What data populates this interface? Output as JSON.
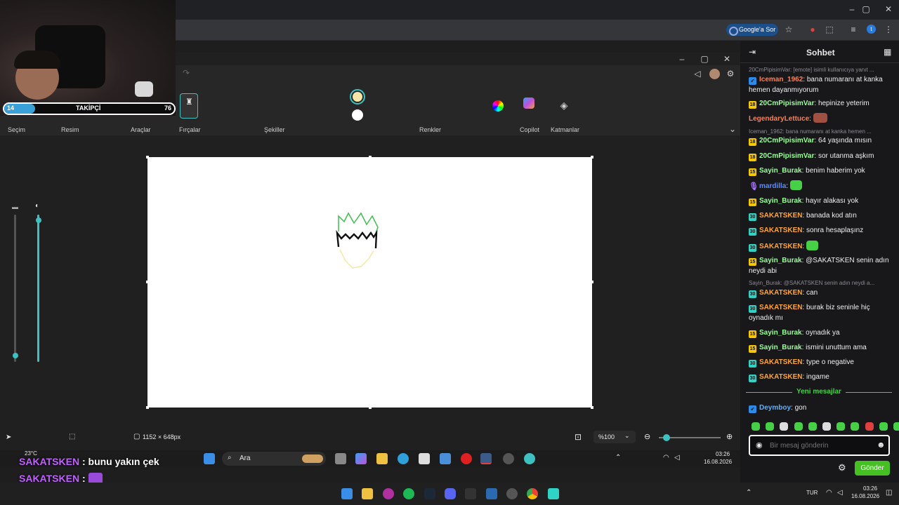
{
  "browser": {
    "ask_label": "Google'a Sor",
    "profile_initial": "t"
  },
  "follower_bar": {
    "current": "14",
    "label": "TAKİPÇİ",
    "goal": "76",
    "progress_fraction": 0.18
  },
  "paint": {
    "ribbon_groups": [
      "Seçim",
      "Resim",
      "Araçlar",
      "Fırçalar",
      "Şekiller",
      "Renkler",
      "Copilot",
      "Katmanlar"
    ],
    "canvas_size": "1152 × 648px",
    "zoom": "%100",
    "colors_row1": [
      "#1b1b1b",
      "#7a7a7a",
      "#8b1a1a",
      "#e02020",
      "#ef7a2b",
      "#f5e23a",
      "#3fbf50",
      "#2ea9df",
      "#3f54c9",
      "#8a3fb8"
    ],
    "colors_row2": [
      "#ffffff",
      "#bdbdbd",
      "#9c6a3c",
      "#f4a8c0",
      "#ffc618",
      "#e8e6a0",
      "#b6e05a",
      "#9bd8ec",
      "#6d7fd0",
      "#b49ad6"
    ],
    "active_color": "#f3e6a8"
  },
  "chat": {
    "title": "Sohbet",
    "new_messages_label": "Yeni mesajlar",
    "input_placeholder": "Bir mesaj gönderin",
    "send_label": "Gönder",
    "messages": [
      {
        "reply": "20CmPipisimVar: [emote] isimli kullanıcıya yanıt ...",
        "badge": "blue",
        "user": "Iceman_1962",
        "color": "#ff7f50",
        "text": "bana numaranı at kanka hemen dayanmıyorum"
      },
      {
        "badge": "18",
        "user": "20CmPipisimVar",
        "color": "#9aff9a",
        "text": "hepinize yeterim"
      },
      {
        "badge": "",
        "user": "LegendaryLettuce",
        "color": "#ff7f50",
        "text": ""
      },
      {
        "reply": "Iceman_1962: bana numaranı at kanka hemen ...",
        "badge": "18",
        "user": "20CmPipisimVar",
        "color": "#9aff9a",
        "text": "64 yaşında mısın"
      },
      {
        "badge": "18",
        "user": "20CmPipisimVar",
        "color": "#9aff9a",
        "text": "sor utanma aşkım"
      },
      {
        "badge": "15",
        "user": "Sayin_Burak",
        "color": "#9aff9a",
        "text": "benim haberim yok"
      },
      {
        "badge": "mic",
        "user": "mardilla",
        "color": "#5b8cff",
        "text": ""
      },
      {
        "badge": "15",
        "user": "Sayin_Burak",
        "color": "#9aff9a",
        "text": "hayır alakası yok"
      },
      {
        "badge": "30",
        "user": "SAKATSKEN",
        "color": "#ffa534",
        "text": "banada kod atın"
      },
      {
        "badge": "30",
        "user": "SAKATSKEN",
        "color": "#ffa534",
        "text": "sonra hesaplaşınz"
      },
      {
        "badge": "30",
        "user": "SAKATSKEN",
        "color": "#ffa534",
        "text": ""
      },
      {
        "badge": "15",
        "user": "Sayin_Burak",
        "color": "#9aff9a",
        "text": "@SAKATSKEN senin adın neydi abi"
      },
      {
        "reply": "Sayin_Burak: @SAKATSKEN senin adın neydi a...",
        "badge": "30",
        "user": "SAKATSKEN",
        "color": "#ffa534",
        "text": "can"
      },
      {
        "badge": "30",
        "user": "SAKATSKEN",
        "color": "#ffa534",
        "text": "burak biz seninle hiç oynadık mı"
      },
      {
        "badge": "15",
        "user": "Sayin_Burak",
        "color": "#9aff9a",
        "text": "oynadık ya"
      },
      {
        "badge": "15",
        "user": "Sayin_Burak",
        "color": "#9aff9a",
        "text": "ismini unuttum ama"
      },
      {
        "badge": "30",
        "user": "SAKATSKEN",
        "color": "#ffa534",
        "text": "type o negative"
      },
      {
        "badge": "30",
        "user": "SAKATSKEN",
        "color": "#ffa534",
        "text": "ingame"
      },
      {
        "badge": "blue",
        "user": "Deymboy",
        "color": "#5ab0ff",
        "text": "gon"
      }
    ]
  },
  "overlay_chat": [
    {
      "user": "SAKATSKEN",
      "text": "bunu yakın çek"
    },
    {
      "user": "SAKATSKEN",
      "text": ""
    }
  ],
  "inner_taskbar": {
    "weather": "23°C",
    "search": "Ara",
    "time": "03:26",
    "date": "16.08.2026"
  },
  "outer_taskbar": {
    "lang": "TUR",
    "time": "03:26",
    "date": "16.08.2026"
  }
}
